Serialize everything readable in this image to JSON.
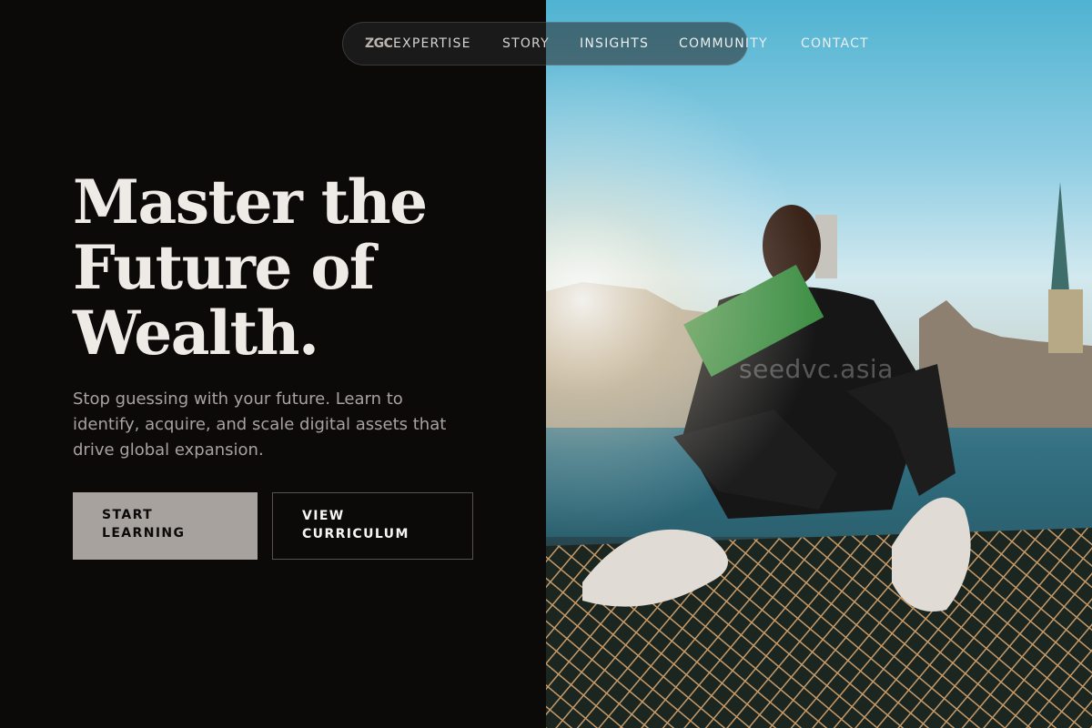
{
  "nav": {
    "logo": "ZGC",
    "links": [
      "EXPERTISE",
      "STORY",
      "INSIGHTS",
      "COMMUNITY",
      "CONTACT"
    ]
  },
  "hero": {
    "headline_lines": [
      "Master the",
      "Future of",
      "Wealth."
    ],
    "subtext": "Stop guessing with your future. Learn to identify, acquire, and scale digital assets that drive global expansion.",
    "primary_button": "START LEARNING",
    "secondary_button": "VIEW CURRICULUM"
  },
  "watermark": "seedvc.asia",
  "colors": {
    "background": "#0c0a09",
    "headline": "#eeebe7",
    "subtext": "#a8a29e",
    "primary_button_bg": "#a8a29e",
    "button_border": "#57534e"
  }
}
